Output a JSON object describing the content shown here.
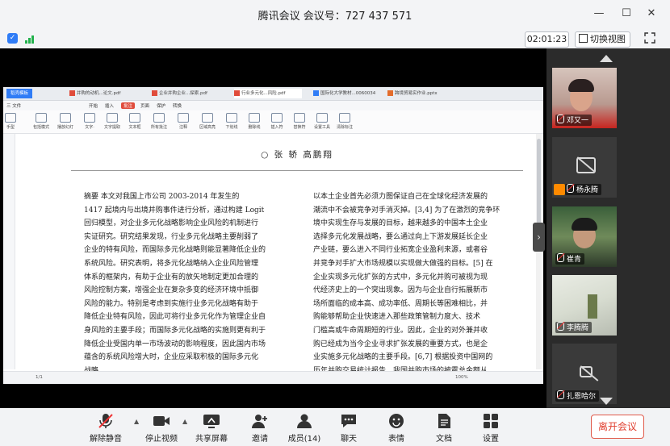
{
  "window": {
    "title": "腾讯会议 会议号：727 437 571",
    "controls": [
      "minimize-icon",
      "maximize-icon",
      "close-icon"
    ]
  },
  "topbar": {
    "timer": "02:01:23",
    "switch_view": "切换视图"
  },
  "shared_doc": {
    "tabs": [
      "稻壳模板",
      "并购的动机...论文.pdf",
      "企业并购企业...探索.pdf",
      "行业多元化...风险.pdf",
      "国际化大学教材...0060034",
      "跨境贸易实作业.pptx"
    ],
    "menu": [
      "三 文件",
      "开始",
      "插入",
      "批注",
      "页面",
      "保护",
      "转换"
    ],
    "ribbon": [
      "手型",
      "选择",
      "包括模式",
      "播放幻灯",
      "文字·",
      "文字提取",
      "文本框",
      "所有批注",
      "注释",
      "区域高亮",
      "下划线",
      "删除线",
      "插入符",
      "替换符",
      "设置工具",
      "清除标注"
    ],
    "authors": "○ 张 轿   高鹏翔",
    "left_col": [
      "摘要  本文对我国上市公司 2003-2014 年发生的",
      "1417 起境内与出境并购事件进行分析，通过构建 Logit",
      "回归模型，对企业多元化战略影响企业风险的机制进行",
      "实证研究。研究结果发现，行业多元化战略主要削弱了",
      "企业的特有风险，而国际多元化战略则能显著降低企业的",
      "系统风险。研究表明，将多元化战略纳入企业风险管理",
      "体系的框架内，有助于企业有的放矢地制定更加合理的",
      "风险控制方案，增强企业在复杂多变的经济环境中抵御",
      "风险的能力。特别是考虑到实施行业多元化战略有助于",
      "降低企业特有风险，因此可将行业多元化作为管理企业自",
      "身风险的主要手段；而国际多元化战略的实施则更有利于",
      "降低企业受国内单一市场波动的影响程度，因此国内市场",
      "蕴含的系统风险增大时，企业应采取积极的国际多元化",
      "战略。"
    ],
    "right_col": [
      "以本土企业首先必须力图保证自己在全球化经济发展的",
      "潮流中不会被竞争对手消灭掉。[3,4] 为了在激烈的竞争环",
      "境中实现生存与发展的目标，越来越多的中国本土企业",
      "选择多元化发展战略，要么通过向上下游发展延长企业",
      "产业链，要么进入不同行业拓宽企业盈利来源，或者谷",
      "并竞争对手扩大市场规模以实现做大做强的目标。[5] 在",
      "企业实现多元化扩张的方式中，多元化并购可被视为现",
      "代经济史上的一个突出现象。因为与企业自行拓展新市",
      "场所面临的成本高、成功率低、周期长等困难相比，并",
      "购能够帮助企业快速进入那些政策管制力度大、技术",
      "门槛高或牛命周期短的行业。因此，企业的对外兼并收",
      "购已经成为当今企业寻求扩张发展的重要方式，也是企",
      "业实施多元化战略的主要手段。[6,7] 根据投资中国网的",
      "历年并购交易统计报告，我国并购市场的披露总金额从"
    ],
    "page_indicator": "1/1",
    "zoom": "100%"
  },
  "participants": [
    {
      "name": "邓又一",
      "video": true
    },
    {
      "name": "杨永腾",
      "video": false,
      "host": true
    },
    {
      "name": "崔青",
      "video": true
    },
    {
      "name": "李腾腾",
      "video": true
    },
    {
      "name": "扎恩哈尔",
      "video": false
    }
  ],
  "bottom_toolbar": {
    "unmute": "解除静音",
    "stop_video": "停止视频",
    "share": "共享屏幕",
    "invite": "邀请",
    "members": "成员(14)",
    "chat": "聊天",
    "emoji": "表情",
    "docs": "文档",
    "settings": "设置",
    "leave": "离开会议"
  },
  "colors": {
    "accent_blue": "#2f7cf6",
    "signal_green": "#22b14c",
    "leave_red": "#e04030"
  }
}
